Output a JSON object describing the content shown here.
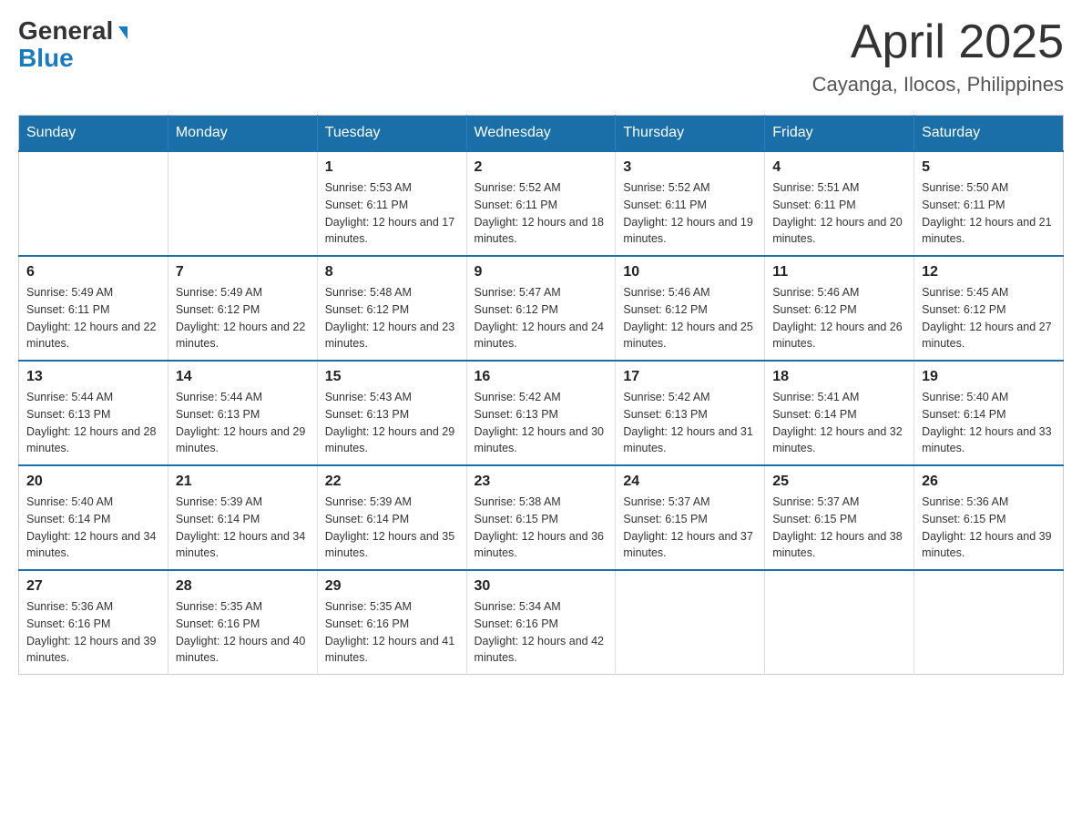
{
  "logo": {
    "general": "General",
    "blue": "Blue"
  },
  "title": "April 2025",
  "subtitle": "Cayanga, Ilocos, Philippines",
  "headers": [
    "Sunday",
    "Monday",
    "Tuesday",
    "Wednesday",
    "Thursday",
    "Friday",
    "Saturday"
  ],
  "weeks": [
    [
      {
        "day": "",
        "sunrise": "",
        "sunset": "",
        "daylight": ""
      },
      {
        "day": "",
        "sunrise": "",
        "sunset": "",
        "daylight": ""
      },
      {
        "day": "1",
        "sunrise": "Sunrise: 5:53 AM",
        "sunset": "Sunset: 6:11 PM",
        "daylight": "Daylight: 12 hours and 17 minutes."
      },
      {
        "day": "2",
        "sunrise": "Sunrise: 5:52 AM",
        "sunset": "Sunset: 6:11 PM",
        "daylight": "Daylight: 12 hours and 18 minutes."
      },
      {
        "day": "3",
        "sunrise": "Sunrise: 5:52 AM",
        "sunset": "Sunset: 6:11 PM",
        "daylight": "Daylight: 12 hours and 19 minutes."
      },
      {
        "day": "4",
        "sunrise": "Sunrise: 5:51 AM",
        "sunset": "Sunset: 6:11 PM",
        "daylight": "Daylight: 12 hours and 20 minutes."
      },
      {
        "day": "5",
        "sunrise": "Sunrise: 5:50 AM",
        "sunset": "Sunset: 6:11 PM",
        "daylight": "Daylight: 12 hours and 21 minutes."
      }
    ],
    [
      {
        "day": "6",
        "sunrise": "Sunrise: 5:49 AM",
        "sunset": "Sunset: 6:11 PM",
        "daylight": "Daylight: 12 hours and 22 minutes."
      },
      {
        "day": "7",
        "sunrise": "Sunrise: 5:49 AM",
        "sunset": "Sunset: 6:12 PM",
        "daylight": "Daylight: 12 hours and 22 minutes."
      },
      {
        "day": "8",
        "sunrise": "Sunrise: 5:48 AM",
        "sunset": "Sunset: 6:12 PM",
        "daylight": "Daylight: 12 hours and 23 minutes."
      },
      {
        "day": "9",
        "sunrise": "Sunrise: 5:47 AM",
        "sunset": "Sunset: 6:12 PM",
        "daylight": "Daylight: 12 hours and 24 minutes."
      },
      {
        "day": "10",
        "sunrise": "Sunrise: 5:46 AM",
        "sunset": "Sunset: 6:12 PM",
        "daylight": "Daylight: 12 hours and 25 minutes."
      },
      {
        "day": "11",
        "sunrise": "Sunrise: 5:46 AM",
        "sunset": "Sunset: 6:12 PM",
        "daylight": "Daylight: 12 hours and 26 minutes."
      },
      {
        "day": "12",
        "sunrise": "Sunrise: 5:45 AM",
        "sunset": "Sunset: 6:12 PM",
        "daylight": "Daylight: 12 hours and 27 minutes."
      }
    ],
    [
      {
        "day": "13",
        "sunrise": "Sunrise: 5:44 AM",
        "sunset": "Sunset: 6:13 PM",
        "daylight": "Daylight: 12 hours and 28 minutes."
      },
      {
        "day": "14",
        "sunrise": "Sunrise: 5:44 AM",
        "sunset": "Sunset: 6:13 PM",
        "daylight": "Daylight: 12 hours and 29 minutes."
      },
      {
        "day": "15",
        "sunrise": "Sunrise: 5:43 AM",
        "sunset": "Sunset: 6:13 PM",
        "daylight": "Daylight: 12 hours and 29 minutes."
      },
      {
        "day": "16",
        "sunrise": "Sunrise: 5:42 AM",
        "sunset": "Sunset: 6:13 PM",
        "daylight": "Daylight: 12 hours and 30 minutes."
      },
      {
        "day": "17",
        "sunrise": "Sunrise: 5:42 AM",
        "sunset": "Sunset: 6:13 PM",
        "daylight": "Daylight: 12 hours and 31 minutes."
      },
      {
        "day": "18",
        "sunrise": "Sunrise: 5:41 AM",
        "sunset": "Sunset: 6:14 PM",
        "daylight": "Daylight: 12 hours and 32 minutes."
      },
      {
        "day": "19",
        "sunrise": "Sunrise: 5:40 AM",
        "sunset": "Sunset: 6:14 PM",
        "daylight": "Daylight: 12 hours and 33 minutes."
      }
    ],
    [
      {
        "day": "20",
        "sunrise": "Sunrise: 5:40 AM",
        "sunset": "Sunset: 6:14 PM",
        "daylight": "Daylight: 12 hours and 34 minutes."
      },
      {
        "day": "21",
        "sunrise": "Sunrise: 5:39 AM",
        "sunset": "Sunset: 6:14 PM",
        "daylight": "Daylight: 12 hours and 34 minutes."
      },
      {
        "day": "22",
        "sunrise": "Sunrise: 5:39 AM",
        "sunset": "Sunset: 6:14 PM",
        "daylight": "Daylight: 12 hours and 35 minutes."
      },
      {
        "day": "23",
        "sunrise": "Sunrise: 5:38 AM",
        "sunset": "Sunset: 6:15 PM",
        "daylight": "Daylight: 12 hours and 36 minutes."
      },
      {
        "day": "24",
        "sunrise": "Sunrise: 5:37 AM",
        "sunset": "Sunset: 6:15 PM",
        "daylight": "Daylight: 12 hours and 37 minutes."
      },
      {
        "day": "25",
        "sunrise": "Sunrise: 5:37 AM",
        "sunset": "Sunset: 6:15 PM",
        "daylight": "Daylight: 12 hours and 38 minutes."
      },
      {
        "day": "26",
        "sunrise": "Sunrise: 5:36 AM",
        "sunset": "Sunset: 6:15 PM",
        "daylight": "Daylight: 12 hours and 39 minutes."
      }
    ],
    [
      {
        "day": "27",
        "sunrise": "Sunrise: 5:36 AM",
        "sunset": "Sunset: 6:16 PM",
        "daylight": "Daylight: 12 hours and 39 minutes."
      },
      {
        "day": "28",
        "sunrise": "Sunrise: 5:35 AM",
        "sunset": "Sunset: 6:16 PM",
        "daylight": "Daylight: 12 hours and 40 minutes."
      },
      {
        "day": "29",
        "sunrise": "Sunrise: 5:35 AM",
        "sunset": "Sunset: 6:16 PM",
        "daylight": "Daylight: 12 hours and 41 minutes."
      },
      {
        "day": "30",
        "sunrise": "Sunrise: 5:34 AM",
        "sunset": "Sunset: 6:16 PM",
        "daylight": "Daylight: 12 hours and 42 minutes."
      },
      {
        "day": "",
        "sunrise": "",
        "sunset": "",
        "daylight": ""
      },
      {
        "day": "",
        "sunrise": "",
        "sunset": "",
        "daylight": ""
      },
      {
        "day": "",
        "sunrise": "",
        "sunset": "",
        "daylight": ""
      }
    ]
  ]
}
